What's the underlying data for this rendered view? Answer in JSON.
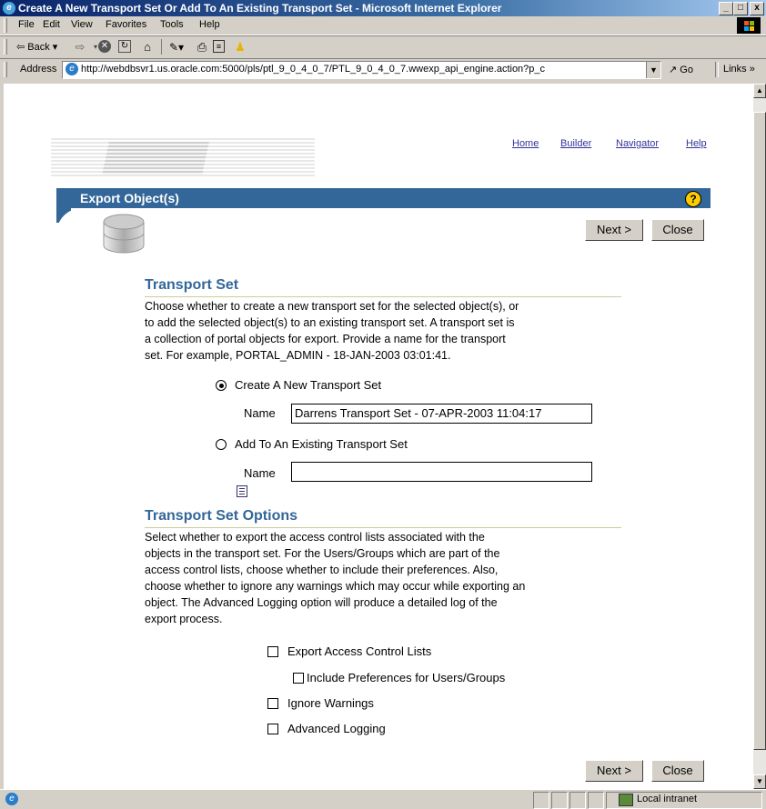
{
  "window": {
    "title": "Create A New Transport Set Or Add To An Existing Transport Set - Microsoft Internet Explorer",
    "controls": [
      "_",
      "□",
      "x"
    ]
  },
  "menu": [
    "File",
    "Edit",
    "View",
    "Favorites",
    "Tools",
    "Help"
  ],
  "toolbar": {
    "back_label": "Back",
    "icons": [
      "back-arrow-icon",
      "forward-arrow-icon",
      "stop-icon",
      "refresh-icon",
      "home-icon",
      "edit-icon",
      "print-icon",
      "discuss-icon",
      "messenger-icon"
    ]
  },
  "address": {
    "label": "Address",
    "url": "http://webdbsvr1.us.oracle.com:5000/pls/ptl_9_0_4_0_7/PTL_9_0_4_0_7.wwexp_api_engine.action?p_c",
    "go_label": "Go",
    "links_label": "Links"
  },
  "page": {
    "top_links": [
      "Home",
      "Builder",
      "Navigator",
      "Help"
    ],
    "banner_title": "Export Object(s)",
    "help_icon_text": "?",
    "buttons": {
      "next": "Next >",
      "close": "Close"
    },
    "transport_set": {
      "heading": "Transport Set",
      "description_lines": [
        "Choose whether to create a new transport set for the selected object(s), or",
        "to add the selected object(s) to an existing transport set. A transport set is",
        "a collection of portal objects for export. Provide a name for the transport",
        "set. For example, PORTAL_ADMIN - 18-JAN-2003 03:01:41."
      ],
      "create_new_label": "Create A New Transport Set",
      "create_new_selected": true,
      "name_label": "Name",
      "new_name_value": "Darrens Transport Set - 07-APR-2003 11:04:17",
      "add_existing_label": "Add To An Existing Transport Set",
      "existing_name_value": ""
    },
    "options": {
      "heading": "Transport Set Options",
      "description_lines": [
        "Select whether to export the access control lists associated with the",
        "objects in the transport set. For the Users/Groups which are part of the",
        "access control lists, choose whether to include their preferences. Also,",
        "choose whether to ignore any warnings which may occur while exporting an",
        "object. The Advanced Logging option will produce a detailed log of the",
        "export process."
      ],
      "checkboxes": [
        {
          "label": "Export Access Control Lists",
          "checked": false
        },
        {
          "label": "Include Preferences for Users/Groups",
          "checked": false
        },
        {
          "label": "Ignore Warnings",
          "checked": false
        },
        {
          "label": "Advanced Logging",
          "checked": false
        }
      ]
    }
  },
  "status": {
    "zone_label": "Local intranet"
  }
}
